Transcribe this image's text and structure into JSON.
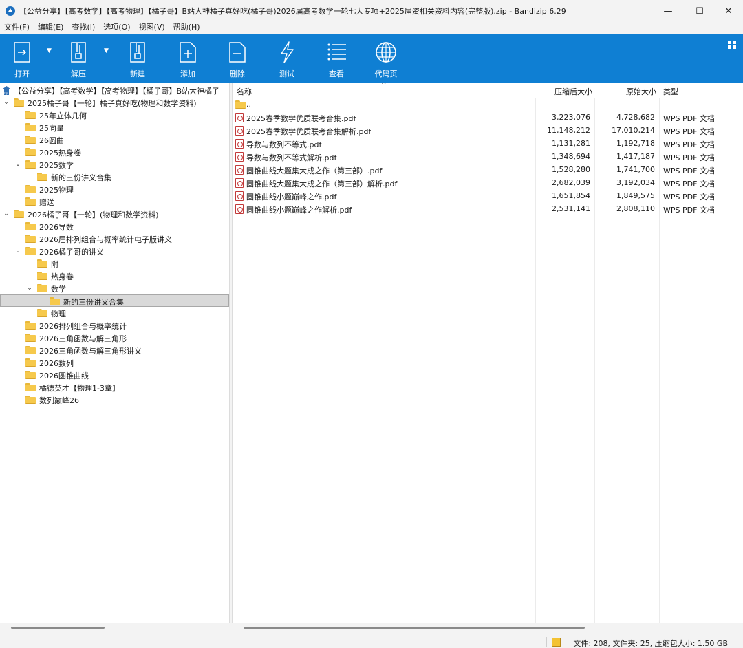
{
  "window": {
    "title": "【公益分享】【高考数学】【高考物理】【橘子哥】B站大神橘子真好吃(橘子哥)2026届高考数学一轮七大专项+2025届资相关资料内容(完整版).zip - Bandizip 6.29",
    "min": "—",
    "max": "☐",
    "close": "✕"
  },
  "menu": [
    "文件(F)",
    "编辑(E)",
    "查找(I)",
    "选项(O)",
    "视图(V)",
    "帮助(H)"
  ],
  "toolbar": {
    "open": "打开",
    "extract": "解压",
    "new": "新建",
    "add": "添加",
    "delete": "删除",
    "test": "测试",
    "view": "查看",
    "codepage": "代码页"
  },
  "tree": {
    "root": "【公益分享】【高考数学】【高考物理】【橘子哥】B站大神橘子",
    "items": [
      {
        "label": "2025橘子哥【一轮】橘子真好吃(物理和数学资料)",
        "level": 0,
        "expanded": true
      },
      {
        "label": "25年立体几何",
        "level": 1
      },
      {
        "label": "25向量",
        "level": 1
      },
      {
        "label": "26圆曲",
        "level": 1
      },
      {
        "label": "2025热身卷",
        "level": 1
      },
      {
        "label": "2025数学",
        "level": 1,
        "expanded": true
      },
      {
        "label": "新的三份讲义合集",
        "level": 2
      },
      {
        "label": "2025物理",
        "level": 1
      },
      {
        "label": "赠送",
        "level": 1
      },
      {
        "label": "2026橘子哥【一轮】(物理和数学资料)",
        "level": 0,
        "expanded": true
      },
      {
        "label": "2026导数",
        "level": 1
      },
      {
        "label": "2026届排列组合与概率统计电子版讲义",
        "level": 1
      },
      {
        "label": "2026橘子哥的讲义",
        "level": 1,
        "expanded": true
      },
      {
        "label": "附",
        "level": 2
      },
      {
        "label": "热身卷",
        "level": 2
      },
      {
        "label": "数学",
        "level": 2,
        "expanded": true
      },
      {
        "label": "新的三份讲义合集",
        "level": 3,
        "selected": true
      },
      {
        "label": "物理",
        "level": 2
      },
      {
        "label": "2026排列组合与概率统计",
        "level": 1
      },
      {
        "label": "2026三角函数与解三角形",
        "level": 1
      },
      {
        "label": "2026三角函数与解三角形讲义",
        "level": 1
      },
      {
        "label": "2026数列",
        "level": 1
      },
      {
        "label": "2026圆锥曲线",
        "level": 1
      },
      {
        "label": "橘德英才【物理1-3章】",
        "level": 1
      },
      {
        "label": "数列巅峰26",
        "level": 1
      }
    ]
  },
  "list": {
    "columns": {
      "name": "名称",
      "packed": "压缩后大小",
      "original": "原始大小",
      "type": "类型"
    },
    "parent": "..",
    "rows": [
      {
        "name": "2025春季数学优质联考合集.pdf",
        "packed": "3,223,076",
        "original": "4,728,682",
        "type": "WPS PDF 文档"
      },
      {
        "name": "2025春季数学优质联考合集解析.pdf",
        "packed": "11,148,212",
        "original": "17,010,214",
        "type": "WPS PDF 文档"
      },
      {
        "name": "导数与数列不等式.pdf",
        "packed": "1,131,281",
        "original": "1,192,718",
        "type": "WPS PDF 文档"
      },
      {
        "name": "导数与数列不等式解析.pdf",
        "packed": "1,348,694",
        "original": "1,417,187",
        "type": "WPS PDF 文档"
      },
      {
        "name": "圆锥曲线大题集大成之作（第三部）.pdf",
        "packed": "1,528,280",
        "original": "1,741,700",
        "type": "WPS PDF 文档"
      },
      {
        "name": "圆锥曲线大题集大成之作（第三部）解析.pdf",
        "packed": "2,682,039",
        "original": "3,192,034",
        "type": "WPS PDF 文档"
      },
      {
        "name": "圆锥曲线小题巅峰之作.pdf",
        "packed": "1,651,854",
        "original": "1,849,575",
        "type": "WPS PDF 文档"
      },
      {
        "name": "圆锥曲线小题巅峰之作解析.pdf",
        "packed": "2,531,141",
        "original": "2,808,110",
        "type": "WPS PDF 文档"
      }
    ]
  },
  "status": {
    "summary": "文件: 208, 文件夹: 25, 压缩包大小: 1.50 GB"
  },
  "colors": {
    "toolbar": "#0f7fd3",
    "folder": "#f6c94c",
    "pdf": "#c23a3a",
    "selection": "#d9d9d9"
  }
}
